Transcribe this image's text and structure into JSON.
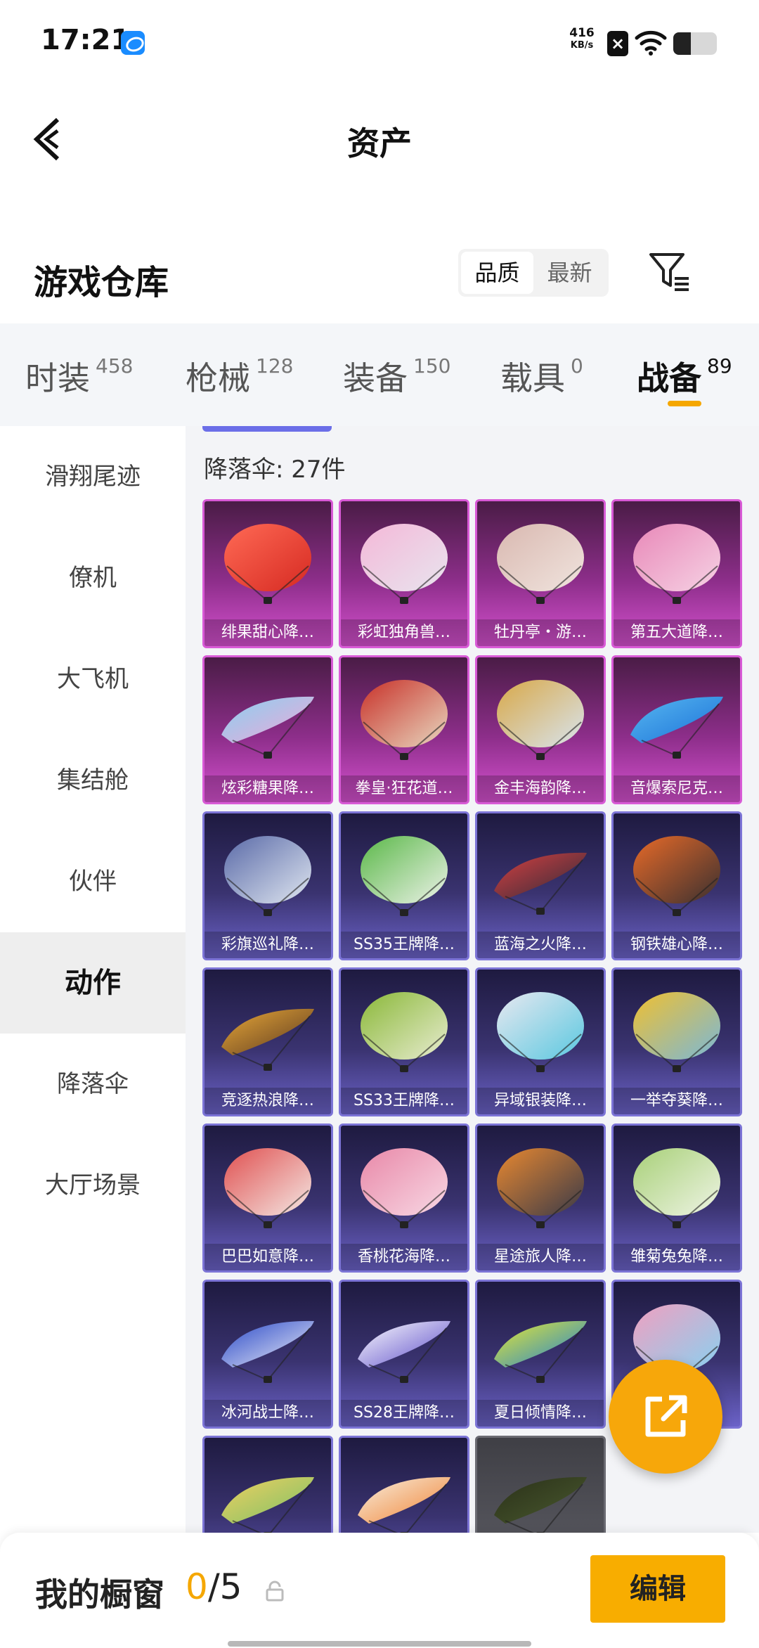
{
  "status_bar": {
    "time": "17:21",
    "speed_value": "416",
    "speed_unit": "KB/s",
    "battery_level": 0.4
  },
  "header": {
    "title": "资产"
  },
  "warehouse": {
    "title": "游戏仓库",
    "sort_options": [
      "品质",
      "最新"
    ],
    "active_sort": "品质"
  },
  "tabs": [
    {
      "label": "时装",
      "count": "458"
    },
    {
      "label": "枪械",
      "count": "128"
    },
    {
      "label": "装备",
      "count": "150"
    },
    {
      "label": "载具",
      "count": "0"
    },
    {
      "label": "战备",
      "count": "89"
    }
  ],
  "active_tab": "战备",
  "sidebar": [
    {
      "label": "滑翔尾迹"
    },
    {
      "label": "僚机"
    },
    {
      "label": "大飞机"
    },
    {
      "label": "集结舱"
    },
    {
      "label": "伙伴"
    },
    {
      "label": "动作"
    },
    {
      "label": "降落伞"
    },
    {
      "label": "大厅场景"
    }
  ],
  "active_sidebar": "动作",
  "content": {
    "count_label": "降落伞: 27件",
    "items": [
      {
        "name": "绯果甜心降…",
        "rarity": "legend",
        "shape": "round",
        "colors": [
          "#d62a22",
          "#ff6a55"
        ]
      },
      {
        "name": "彩虹独角兽…",
        "rarity": "legend",
        "shape": "round",
        "colors": [
          "#e8e4ee",
          "#f4b8d8"
        ]
      },
      {
        "name": "牡丹亭・游…",
        "rarity": "legend",
        "shape": "round",
        "colors": [
          "#f0e4de",
          "#d9b8b0"
        ]
      },
      {
        "name": "第五大道降…",
        "rarity": "legend",
        "shape": "round",
        "colors": [
          "#f6d2e4",
          "#e888b8"
        ]
      },
      {
        "name": "炫彩糖果降…",
        "rarity": "legend",
        "shape": "wing",
        "colors": [
          "#f0a8d8",
          "#8ad0f0"
        ]
      },
      {
        "name": "拳皇·狂花道…",
        "rarity": "legend",
        "shape": "round",
        "colors": [
          "#e8d8c0",
          "#c83028"
        ]
      },
      {
        "name": "金丰海韵降…",
        "rarity": "legend",
        "shape": "round",
        "colors": [
          "#d8e4ee",
          "#d8a848"
        ]
      },
      {
        "name": "音爆索尼克…",
        "rarity": "legend",
        "shape": "wing",
        "colors": [
          "#1a70d8",
          "#58b8f0"
        ]
      },
      {
        "name": "彩旗巡礼降…",
        "rarity": "epic",
        "shape": "round",
        "colors": [
          "#dfe6f0",
          "#5a6aa8"
        ]
      },
      {
        "name": "SS35王牌降…",
        "rarity": "epic",
        "shape": "round",
        "colors": [
          "#ecf2e8",
          "#5ab848"
        ]
      },
      {
        "name": "蓝海之火降…",
        "rarity": "epic",
        "shape": "wing",
        "colors": [
          "#2a2a3a",
          "#d84040"
        ]
      },
      {
        "name": "钢铁雄心降…",
        "rarity": "epic",
        "shape": "round",
        "colors": [
          "#3a3030",
          "#e86a28"
        ]
      },
      {
        "name": "竞逐热浪降…",
        "rarity": "epic",
        "shape": "wing",
        "colors": [
          "#5a3820",
          "#e8a838"
        ]
      },
      {
        "name": "SS33王牌降…",
        "rarity": "epic",
        "shape": "round",
        "colors": [
          "#e8ecd0",
          "#8ab838"
        ]
      },
      {
        "name": "异域银装降…",
        "rarity": "epic",
        "shape": "round",
        "colors": [
          "#5ac8e0",
          "#e8e8f0"
        ]
      },
      {
        "name": "一举夺葵降…",
        "rarity": "epic",
        "shape": "round",
        "colors": [
          "#7ab8d8",
          "#f0c030"
        ]
      },
      {
        "name": "巴巴如意降…",
        "rarity": "epic",
        "shape": "round",
        "colors": [
          "#f4e8e4",
          "#e05050"
        ]
      },
      {
        "name": "香桃花海降…",
        "rarity": "epic",
        "shape": "round",
        "colors": [
          "#f8d8e4",
          "#e888a8"
        ]
      },
      {
        "name": "星途旅人降…",
        "rarity": "epic",
        "shape": "round",
        "colors": [
          "#3a3a48",
          "#e88830"
        ]
      },
      {
        "name": "雏菊兔兔降…",
        "rarity": "epic",
        "shape": "round",
        "colors": [
          "#eef4e4",
          "#a8d078"
        ]
      },
      {
        "name": "冰河战士降…",
        "rarity": "epic",
        "shape": "wing",
        "colors": [
          "#f0f0f8",
          "#2848c8"
        ]
      },
      {
        "name": "SS28王牌降…",
        "rarity": "epic",
        "shape": "wing",
        "colors": [
          "#5848c8",
          "#ffffff"
        ]
      },
      {
        "name": "夏日倾情降…",
        "rarity": "epic",
        "shape": "wing",
        "colors": [
          "#1a80d8",
          "#e8e830"
        ]
      },
      {
        "name": "",
        "rarity": "epic",
        "shape": "round",
        "colors": [
          "#8ad0f0",
          "#f0a0c0"
        ]
      },
      {
        "name": "",
        "rarity": "epic",
        "shape": "wing",
        "colors": [
          "#7ac068",
          "#f0d060"
        ]
      },
      {
        "name": "",
        "rarity": "epic",
        "shape": "wing",
        "colors": [
          "#f08030",
          "#f8f0e0"
        ]
      },
      {
        "name": "",
        "rarity": "gray",
        "shape": "wing",
        "colors": [
          "#4a5a30",
          "#2a3018"
        ]
      }
    ]
  },
  "bottom_bar": {
    "showcase_label": "我的橱窗",
    "showcase_current": "0",
    "showcase_total": "/5",
    "edit_label": "编辑"
  }
}
